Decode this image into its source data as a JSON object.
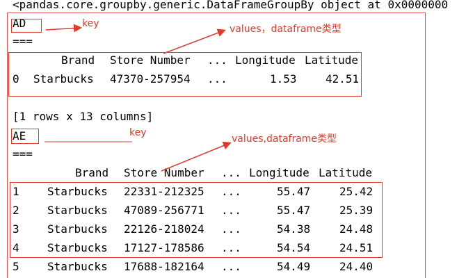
{
  "console": {
    "header": "<pandas.core.groupby.generic.DataFrameGroupBy object at 0x0000000",
    "group1": {
      "key": "AD",
      "separator": "===",
      "columns": [
        "Brand",
        "Store Number",
        "...",
        "Longitude",
        "Latitude"
      ],
      "rows": [
        {
          "index": "0",
          "brand": "Starbucks",
          "store": "47370-257954",
          "ellipsis": "...",
          "longitude": "1.53",
          "latitude": "42.51"
        }
      ],
      "shape": "[1 rows x 13 columns]"
    },
    "group2": {
      "key": "AE",
      "separator": "===",
      "columns": [
        "Brand",
        "Store Number",
        "...",
        "Longitude",
        "Latitude"
      ],
      "rows": [
        {
          "index": "1",
          "brand": "Starbucks",
          "store": "22331-212325",
          "ellipsis": "...",
          "longitude": "55.47",
          "latitude": "25.42"
        },
        {
          "index": "2",
          "brand": "Starbucks",
          "store": "47089-256771",
          "ellipsis": "...",
          "longitude": "55.47",
          "latitude": "25.39"
        },
        {
          "index": "3",
          "brand": "Starbucks",
          "store": "22126-218024",
          "ellipsis": "...",
          "longitude": "54.38",
          "latitude": "24.48"
        },
        {
          "index": "4",
          "brand": "Starbucks",
          "store": "17127-178586",
          "ellipsis": "...",
          "longitude": "54.54",
          "latitude": "24.51"
        },
        {
          "index": "5",
          "brand": "Starbucks",
          "store": "17688-182164",
          "ellipsis": "...",
          "longitude": "54.49",
          "latitude": "24.40"
        }
      ]
    }
  },
  "annotations": {
    "key1": "key",
    "values1": "values，dataframe类型",
    "key2": "key",
    "values2": "values,dataframe类型"
  },
  "colors": {
    "annotation": "#e03a2c",
    "text": "#000000",
    "background": "#ffffff"
  }
}
